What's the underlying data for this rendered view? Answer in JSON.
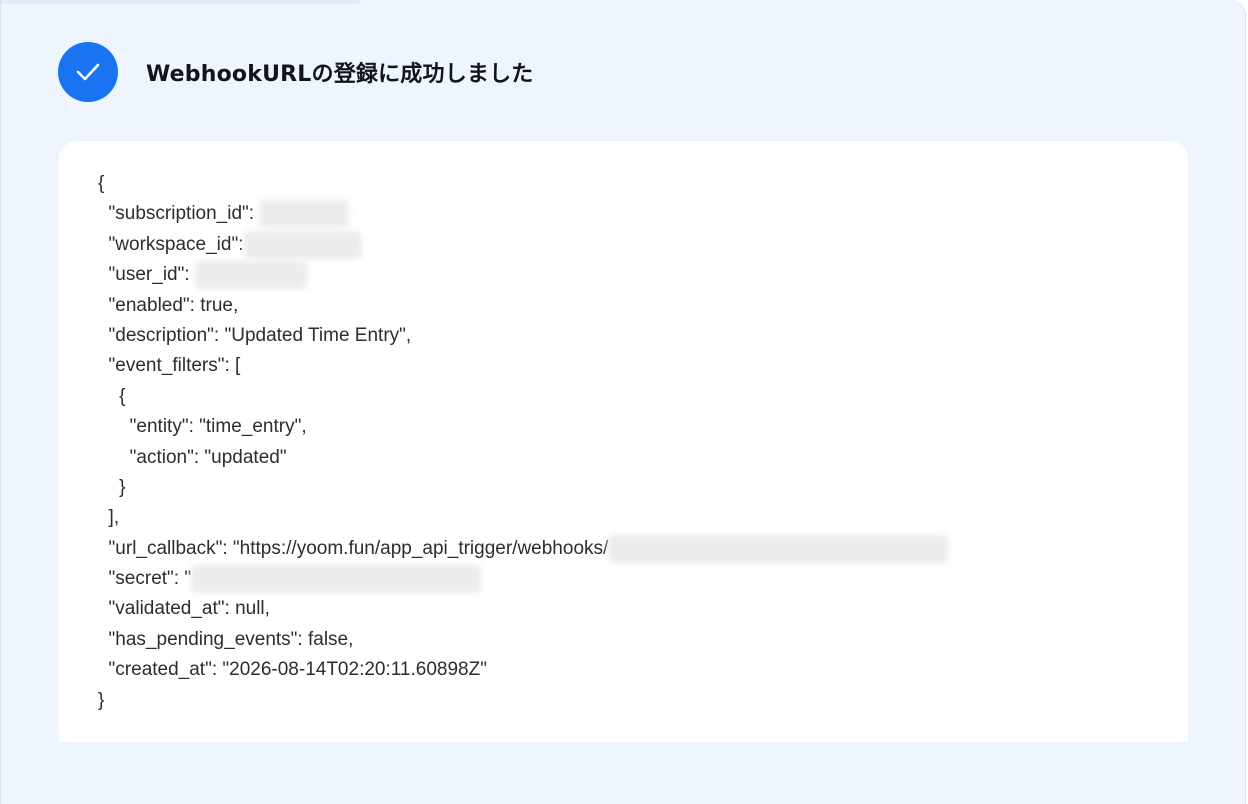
{
  "header": {
    "title": "WebhookURLの登録に成功しました",
    "icon": "check-icon",
    "accent_color": "#1a73f0"
  },
  "code": {
    "lines": [
      "{",
      "  \"subscription_id\": ",
      "  \"workspace_id\":",
      "  \"user_id\": ",
      "  \"enabled\": true,",
      "  \"description\": \"Updated Time Entry\",",
      "  \"event_filters\": [",
      "    {",
      "      \"entity\": \"time_entry\",",
      "      \"action\": \"updated\"",
      "    }",
      "  ],",
      "  \"url_callback\": \"https://yoom.fun/app_api_trigger/webhooks/",
      "  \"secret\": \"",
      "  \"validated_at\": null,",
      "  \"has_pending_events\": false,",
      "  \"created_at\": \"2026-08-14T02:20:11.60898Z\"",
      "}"
    ]
  }
}
